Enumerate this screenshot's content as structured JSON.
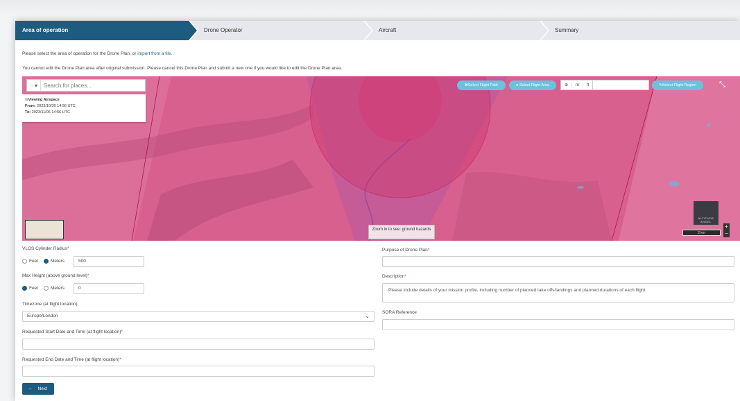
{
  "steps": [
    "Area of operation",
    "Drone Operator",
    "Aircraft",
    "Summary"
  ],
  "info": {
    "line1_prefix": "Please select the area of operation for the Drone Plan, or",
    "line1_link": "import from a file",
    "line1_suffix": ".",
    "line2": "You cannot edit the Drone Plan area after original submission. Please cancel this Drone Plan and submit a new one if you would like to edit the Drone Plan area."
  },
  "map": {
    "search_placeholder": "Search for places...",
    "airspace_title": "Viewing Airspace",
    "from_label": "From:",
    "from_value": "2023/10/30 14:56 UTC",
    "to_label": "To:",
    "to_value": "2023/11/06 14:56 UTC",
    "btn_path": "Select Flight Path",
    "btn_area": "Select Flight Area",
    "unit_m": "m",
    "unit_ft": "ft",
    "btn_region": "Select Flight Region",
    "zoom_note": "Zoom in to see: ground hazards",
    "logo_text": "ALTITUDE ANGEL",
    "scale_text": "2 km",
    "zoom_in": "+",
    "zoom_out": "−"
  },
  "form": {
    "vlos_label": "VLOS Cylinder Radius",
    "vlos_feet": "Feet",
    "vlos_meters": "Meters",
    "vlos_value": "500",
    "maxh_label": "Max Height (above ground level)",
    "maxh_feet": "Feet",
    "maxh_meters": "Meters",
    "maxh_value": "0",
    "tz_label": "Timezone (at flight location)",
    "tz_value": "Europe/London",
    "start_label": "Requested Start Date and Time (at flight location)",
    "end_label": "Requested End Date and Time (at flight location)",
    "purpose_label": "Purpose of Drone Plan",
    "desc_label": "Description",
    "desc_placeholder": "Please include details of your mission profile, including number of planned take offs/landings and planned durations of each flight",
    "sora_label": "SORA Reference",
    "required_mark": "*",
    "next_label": "Next"
  },
  "colors": {
    "accent": "#1d5c7f",
    "map_pink": "#d95a8c",
    "button_blue": "#6fc0dc"
  }
}
